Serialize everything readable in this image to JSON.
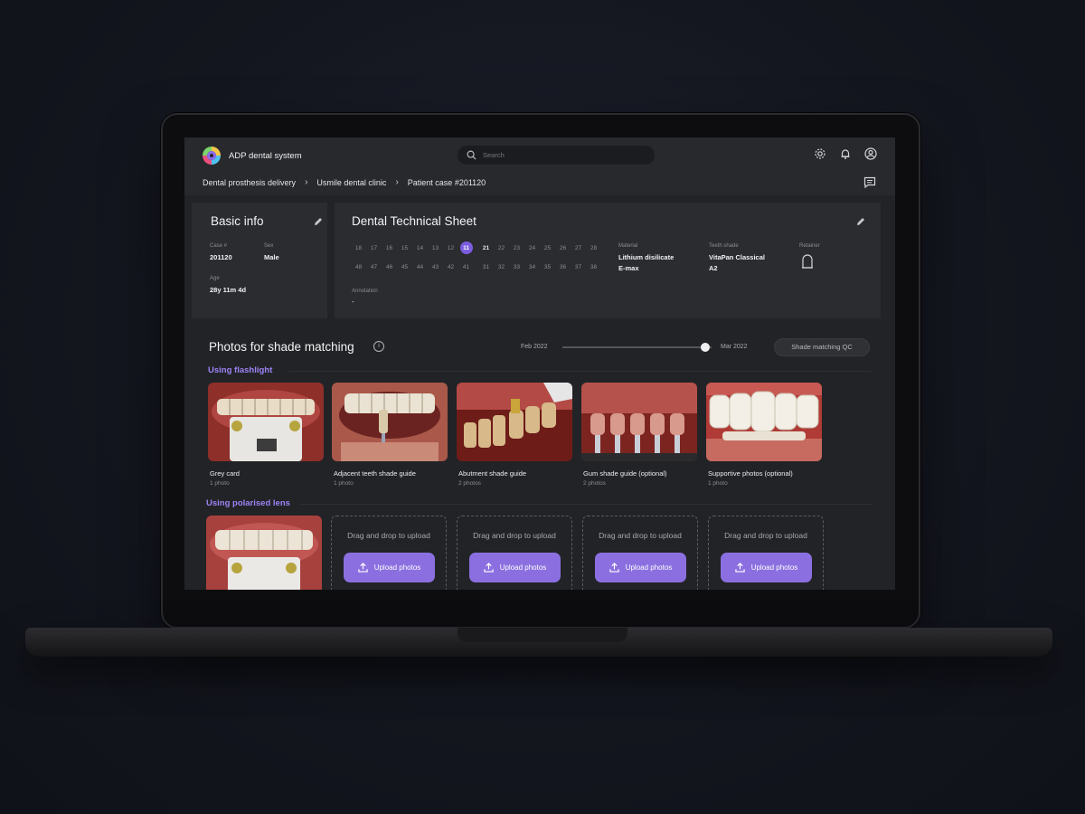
{
  "app": {
    "title": "ADP dental system"
  },
  "search": {
    "placeholder": "Search"
  },
  "breadcrumb": [
    "Dental prosthesis delivery",
    "Usmile dental clinic",
    "Patient case #201120"
  ],
  "basic_info": {
    "title": "Basic info",
    "case_label": "Case #",
    "case_value": "201120",
    "sex_label": "Sex",
    "sex_value": "Male",
    "age_label": "Age",
    "age_value": "28y 11m 4d"
  },
  "tech_sheet": {
    "title": "Dental Technical Sheet",
    "teeth_upper": [
      "18",
      "17",
      "16",
      "15",
      "14",
      "13",
      "12",
      "11",
      "21",
      "22",
      "23",
      "24",
      "25",
      "26",
      "27",
      "28"
    ],
    "teeth_lower": [
      "48",
      "47",
      "46",
      "45",
      "44",
      "43",
      "42",
      "41",
      "31",
      "32",
      "33",
      "34",
      "35",
      "36",
      "37",
      "38"
    ],
    "selected_tooth": "11",
    "material_label": "Material",
    "material_value_1": "Lithium disilicate",
    "material_value_2": "E-max",
    "shade_label": "Teeth shade",
    "shade_value_1": "VitaPan Classical",
    "shade_value_2": "A2",
    "retainer_label": "Retainer",
    "annotation_label": "Annotation",
    "annotation_value": "-"
  },
  "photos": {
    "title": "Photos for shade matching",
    "info_glyph": "i",
    "slider_start": "Feb 2022",
    "slider_end": "Mar 2022",
    "slider_position": 0.96,
    "qc_button": "Shade matching QC",
    "section_flashlight": "Using flashlight",
    "section_polarised": "Using polarised lens",
    "flashlight_cards": [
      {
        "caption": "Grey card",
        "count": "1 photo"
      },
      {
        "caption": "Adjacent teeth shade guide",
        "count": "1 photo"
      },
      {
        "caption": "Abutment shade guide",
        "count": "2 photos"
      },
      {
        "caption": "Gum shade guide (optional)",
        "count": "2 photos"
      },
      {
        "caption": "Supportive photos (optional)",
        "count": "1 photo"
      }
    ],
    "drop_text": "Drag and drop to upload",
    "upload_label": "Upload photos"
  },
  "colors": {
    "accent": "#8b6fe0",
    "section_label": "#9c83f5",
    "selected_tooth": "#7c5de0"
  }
}
